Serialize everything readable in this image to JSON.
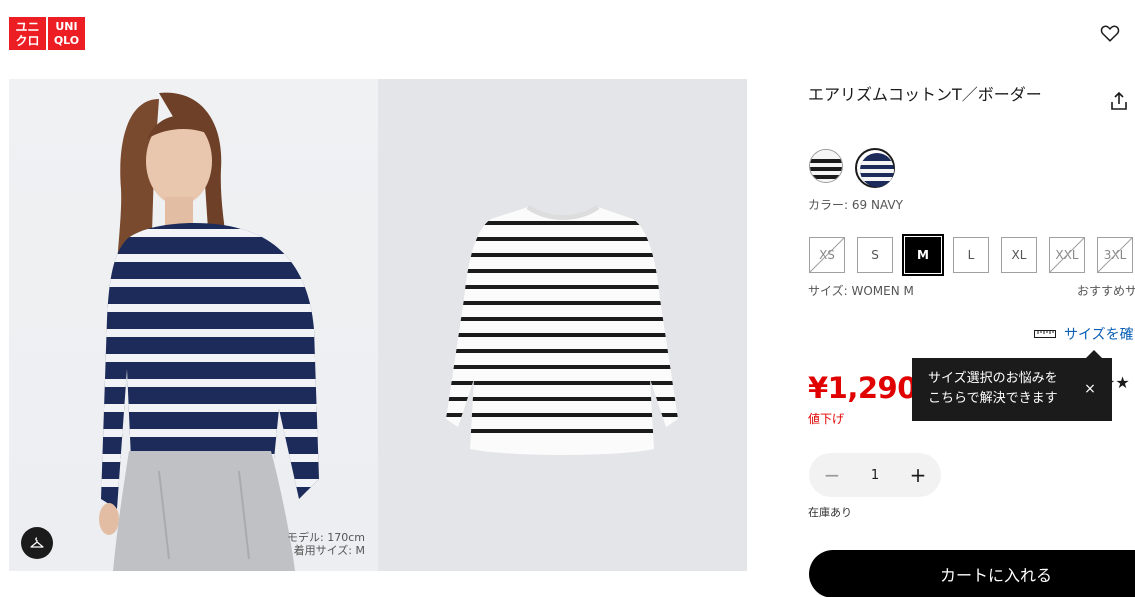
{
  "brand": {
    "logo_line1_left": "ユニ",
    "logo_line2_left": "クロ",
    "logo_line1_right": "UNI",
    "logo_line2_right": "QLO",
    "color": "#ed1d24"
  },
  "header": {
    "wishlist_icon": "heart-icon"
  },
  "gallery": {
    "model_caption_line1": "モデル: 170cm",
    "model_caption_line2": "着用サイズ: M",
    "hanger_icon": "hanger-icon"
  },
  "product": {
    "title": "エアリズムコットンT／ボーダー",
    "share_icon": "share-icon",
    "colors": [
      {
        "name": "white-black-stripe",
        "selected": false
      },
      {
        "name": "navy-stripe",
        "selected": true
      }
    ],
    "color_label": "カラー: 69 NAVY",
    "sizes": [
      {
        "label": "XS",
        "available": false,
        "selected": false
      },
      {
        "label": "S",
        "available": true,
        "selected": false
      },
      {
        "label": "M",
        "available": true,
        "selected": true
      },
      {
        "label": "L",
        "available": true,
        "selected": false
      },
      {
        "label": "XL",
        "available": true,
        "selected": false
      },
      {
        "label": "XXL",
        "available": false,
        "selected": false
      },
      {
        "label": "3XL",
        "available": false,
        "selected": false
      }
    ],
    "size_label": "サイズ: WOMEN M",
    "recommend_label": "おすすめサ",
    "size_check_label": "サイズを確",
    "price": "¥1,290",
    "price_tag": "値下げ",
    "rating_stars": "★★★★★",
    "quantity": "1",
    "qty_minus": "−",
    "qty_plus": "+",
    "stock": "在庫あり",
    "cart_label": "カートに入れる"
  },
  "tooltip": {
    "line1": "サイズ選択のお悩みを",
    "line2": "こちらで解決できます",
    "close": "×"
  },
  "colors": {
    "price_red": "#e10000",
    "link_blue": "#0a5fb4",
    "navy": "#1c2b5a"
  }
}
